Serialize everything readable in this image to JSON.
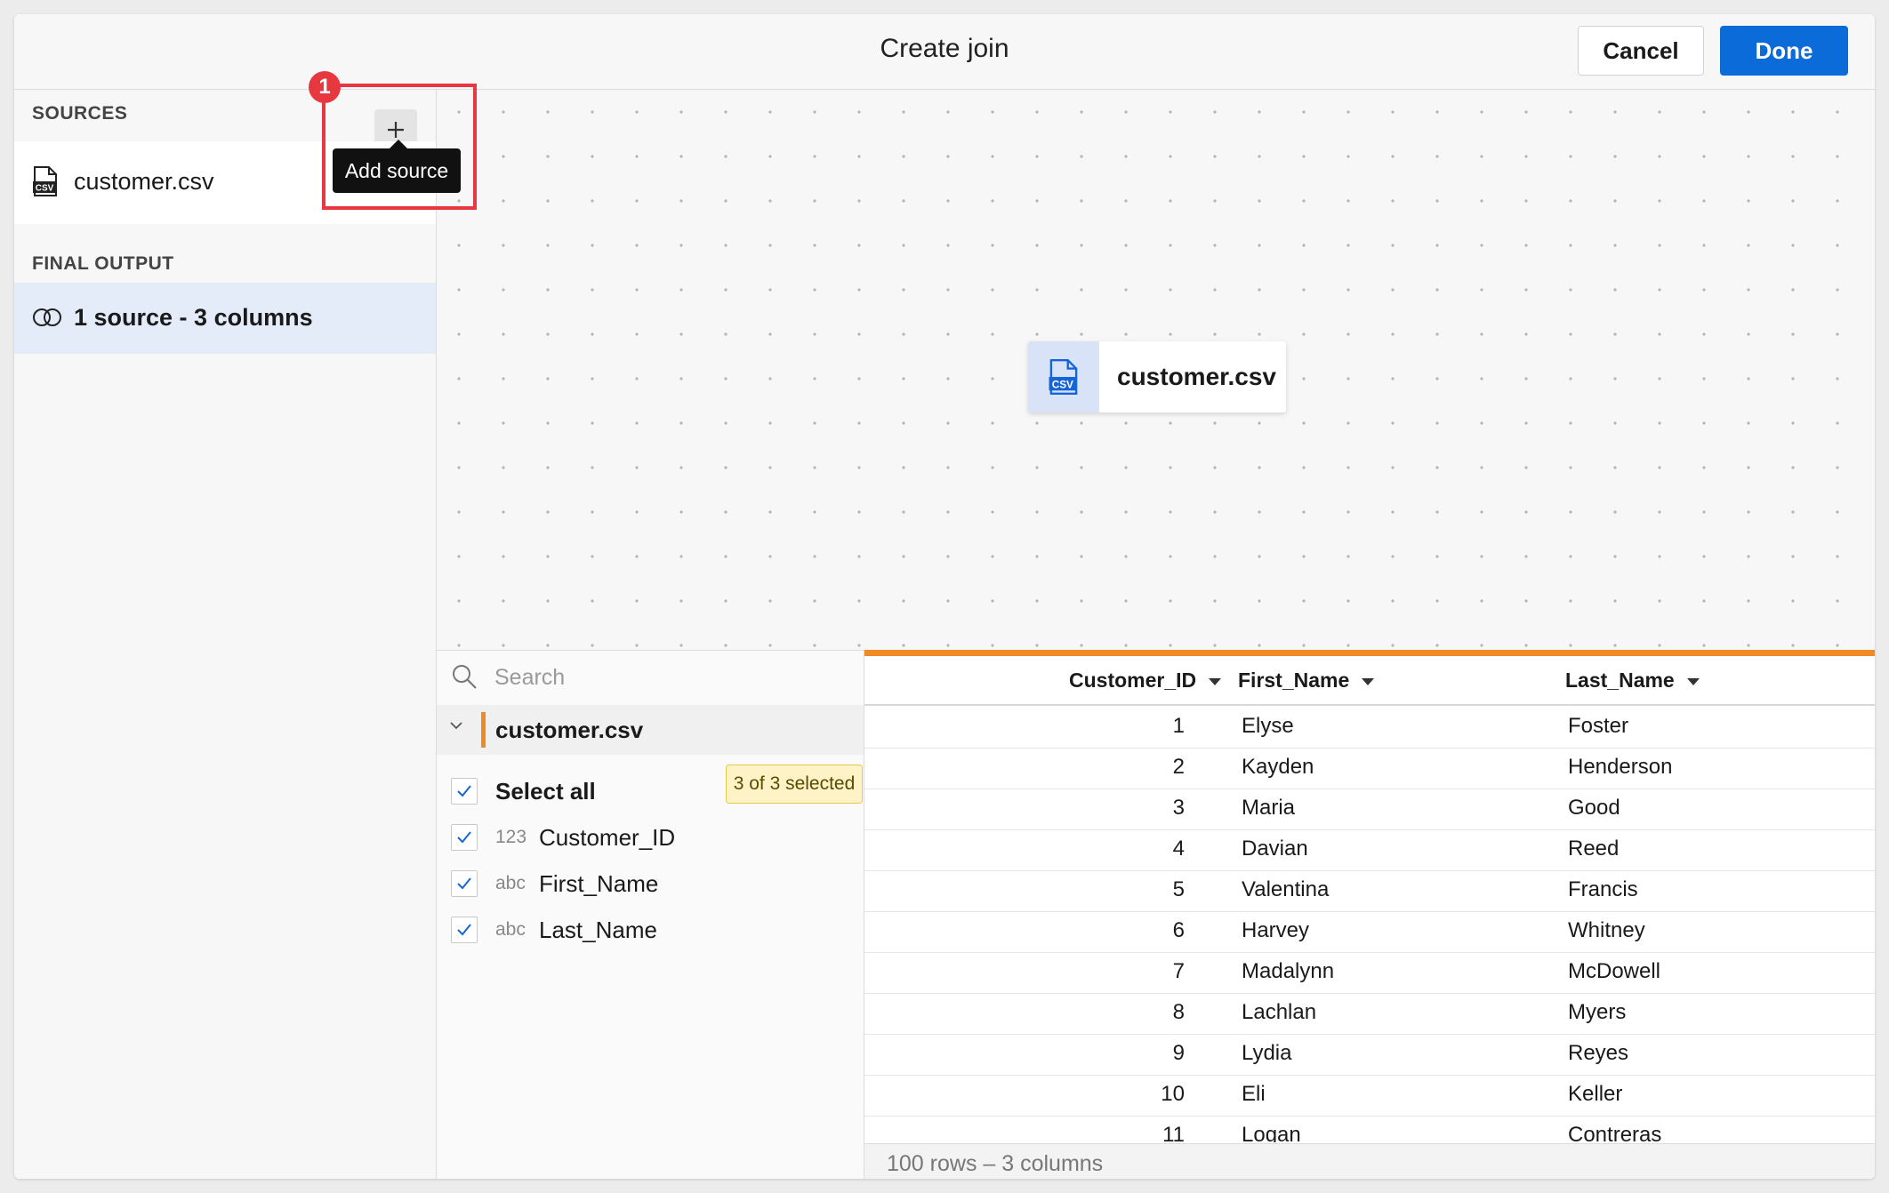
{
  "dialog": {
    "title": "Create join",
    "cancel_label": "Cancel",
    "done_label": "Done"
  },
  "sidebar": {
    "sources_label": "SOURCES",
    "sources": [
      {
        "name": "customer.csv",
        "icon": "csv-file-icon"
      }
    ],
    "add_button_icon": "plus-icon",
    "add_tooltip": "Add source",
    "final_output_label": "FINAL OUTPUT",
    "final_output_item": "1 source - 3 columns"
  },
  "annotation": {
    "step": "1",
    "color": "#e8383f"
  },
  "canvas": {
    "node_label": "customer.csv",
    "node_icon": "csv-file-icon"
  },
  "columns_panel": {
    "search_placeholder": "Search",
    "group_label": "customer.csv",
    "select_all_label": "Select all",
    "selected_badge": "3 of 3 selected",
    "columns": [
      {
        "type": "123",
        "name": "Customer_ID",
        "checked": true
      },
      {
        "type": "abc",
        "name": "First_Name",
        "checked": true
      },
      {
        "type": "abc",
        "name": "Last_Name",
        "checked": true
      }
    ]
  },
  "table": {
    "headers": [
      "Customer_ID",
      "First_Name",
      "Last_Name"
    ],
    "rows": [
      [
        "1",
        "Elyse",
        "Foster"
      ],
      [
        "2",
        "Kayden",
        "Henderson"
      ],
      [
        "3",
        "Maria",
        "Good"
      ],
      [
        "4",
        "Davian",
        "Reed"
      ],
      [
        "5",
        "Valentina",
        "Francis"
      ],
      [
        "6",
        "Harvey",
        "Whitney"
      ],
      [
        "7",
        "Madalynn",
        "McDowell"
      ],
      [
        "8",
        "Lachlan",
        "Myers"
      ],
      [
        "9",
        "Lydia",
        "Reyes"
      ],
      [
        "10",
        "Eli",
        "Keller"
      ],
      [
        "11",
        "Logan",
        "Contreras"
      ]
    ],
    "footer": "100 rows – 3 columns"
  },
  "colors": {
    "accent": "#0b6bd8",
    "orange": "#f08a24",
    "selected_row": "#e4ecfa"
  }
}
